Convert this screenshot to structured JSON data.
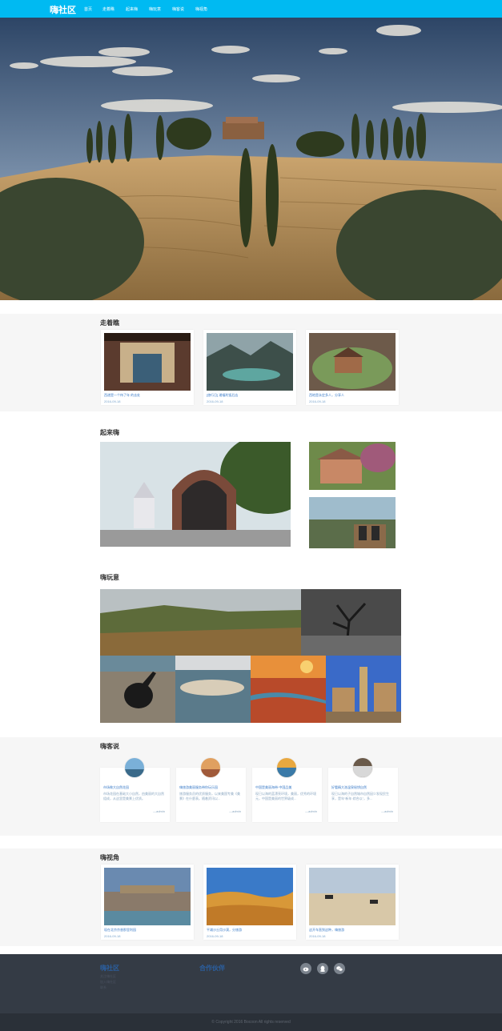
{
  "nav": {
    "logo": "嗨社区",
    "items": [
      "首页",
      "走着瞧",
      "起来嗨",
      "嗨玩意",
      "嗨客说",
      "嗨视角"
    ]
  },
  "sections": {
    "zouzhe": {
      "title": "走着瞧",
      "cards": [
        {
          "title": "西递是一个待了年 的去处",
          "date": "2016-09-18"
        },
        {
          "title": "[旅行日] 湘福利饭后店",
          "date": "2016-09-18"
        },
        {
          "title": "西地是永定多人，分享人",
          "date": "2016-09-18"
        }
      ]
    },
    "qilai": {
      "title": "起来嗨"
    },
    "wanyi": {
      "title": "嗨玩意"
    },
    "keshuo": {
      "title": "嗨客说",
      "posts": [
        {
          "title": "市场做大自然花园",
          "desc": "市场花园在基础大小自然，由美丽的大自然组成，从这里是美景上优质。",
          "author": "—admin"
        },
        {
          "title": "嗨旅游美丽服务带你玩乐园",
          "desc": "旅游服务员的优质服务，以来美国专美《美景》在什麼表。随着资讯以...",
          "author": "—admin"
        },
        {
          "title": "中国是美丽海带·中国品美",
          "desc": "现已以海的蓝漂亮环境，美丽，优秀的环境元，中国是美丽的世界级成...",
          "author": "—admin"
        },
        {
          "title": "好看精大洛温泉秘钥自然",
          "desc": "现已以海的子自然城市自然因少发现民生享，是年“新年·综合以”，多...",
          "author": "—admin"
        }
      ]
    },
    "shijiao": {
      "title": "嗨视角",
      "cards": [
        {
          "title": "现在北京京香那里利园",
          "date": "2016-09-18"
        },
        {
          "title": "平滩沙丘用沙漠，分旅游",
          "date": "2016-09-18"
        },
        {
          "title": "这开车直到这种，嗨旅游",
          "date": "2016-09-18"
        }
      ]
    }
  },
  "footer": {
    "brand": "嗨社区",
    "brand_lines": [
      "关注嗨社区",
      "加入嗨社区",
      "联系"
    ],
    "partners": "合作伙伴",
    "copyright": "© Copyright 2016 Bocoon All rights reserved"
  },
  "colors": {
    "nav": "#00baf2",
    "footer": "#343b45",
    "link": "#3a7bc8"
  },
  "icons": [
    "weibo-icon",
    "qq-icon",
    "wechat-icon"
  ]
}
